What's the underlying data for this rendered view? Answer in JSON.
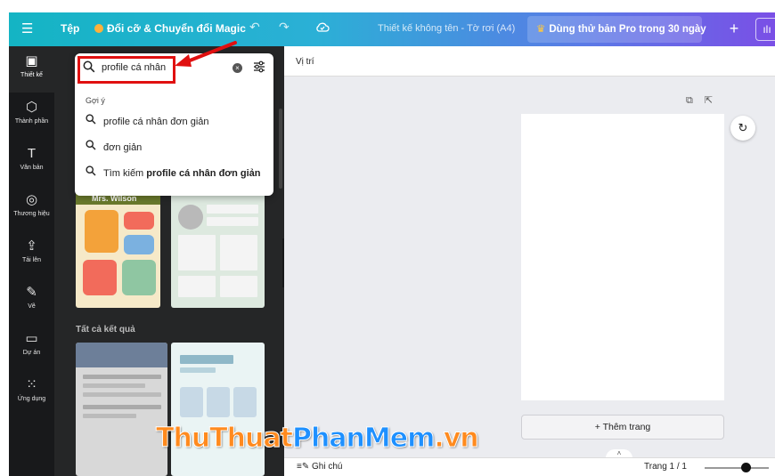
{
  "topbar": {
    "menu_icon": "☰",
    "file": "Tệp",
    "magic_resize": "Đổi cỡ & Chuyển đổi Magic",
    "undo_icon": "↶",
    "redo_icon": "↷",
    "save_status_icon": "cloud-check-icon",
    "doc_title": "Thiết kế không tên - Tờ rơi (A4)",
    "pro_trial": "Dùng thử bản Pro trong 30 ngày",
    "plus": "+",
    "analytics": "ılı"
  },
  "rail": {
    "items": [
      {
        "icon": "▣",
        "label": "Thiết kế"
      },
      {
        "icon": "⬡",
        "label": "Thành phần"
      },
      {
        "icon": "T",
        "label": "Văn bản"
      },
      {
        "icon": "◎",
        "label": "Thương hiệu"
      },
      {
        "icon": "⇪",
        "label": "Tải lên"
      },
      {
        "icon": "✎",
        "label": "Vẽ"
      },
      {
        "icon": "▭",
        "label": "Dự án"
      },
      {
        "icon": "⁙",
        "label": "Ứng dụng"
      }
    ]
  },
  "search": {
    "value": "profile cá nhân",
    "suggestions_title": "Gợi ý",
    "suggestions": [
      "profile cá nhân đơn giản",
      "đơn giản"
    ],
    "search_prefix": "Tìm kiếm ",
    "search_query": "profile cá nhân đơn giản"
  },
  "panel": {
    "template_title": "Mrs. Wilson",
    "all_results": "Tất cả kết quả"
  },
  "canvas": {
    "position_label": "Vị trí",
    "add_page": "+ Thêm trang"
  },
  "bottombar": {
    "notes": "Ghi chú",
    "page_count": "Trang 1 / 1",
    "zoom_level": 0.65
  },
  "watermark": {
    "part1": "ThuThuat",
    "part2": "PhanMem",
    "part3": ".vn"
  },
  "colors": {
    "accent": "#e01010",
    "rail_bg": "#18191b",
    "panel_bg": "#252627",
    "canvas_bg": "#ebecf0"
  }
}
